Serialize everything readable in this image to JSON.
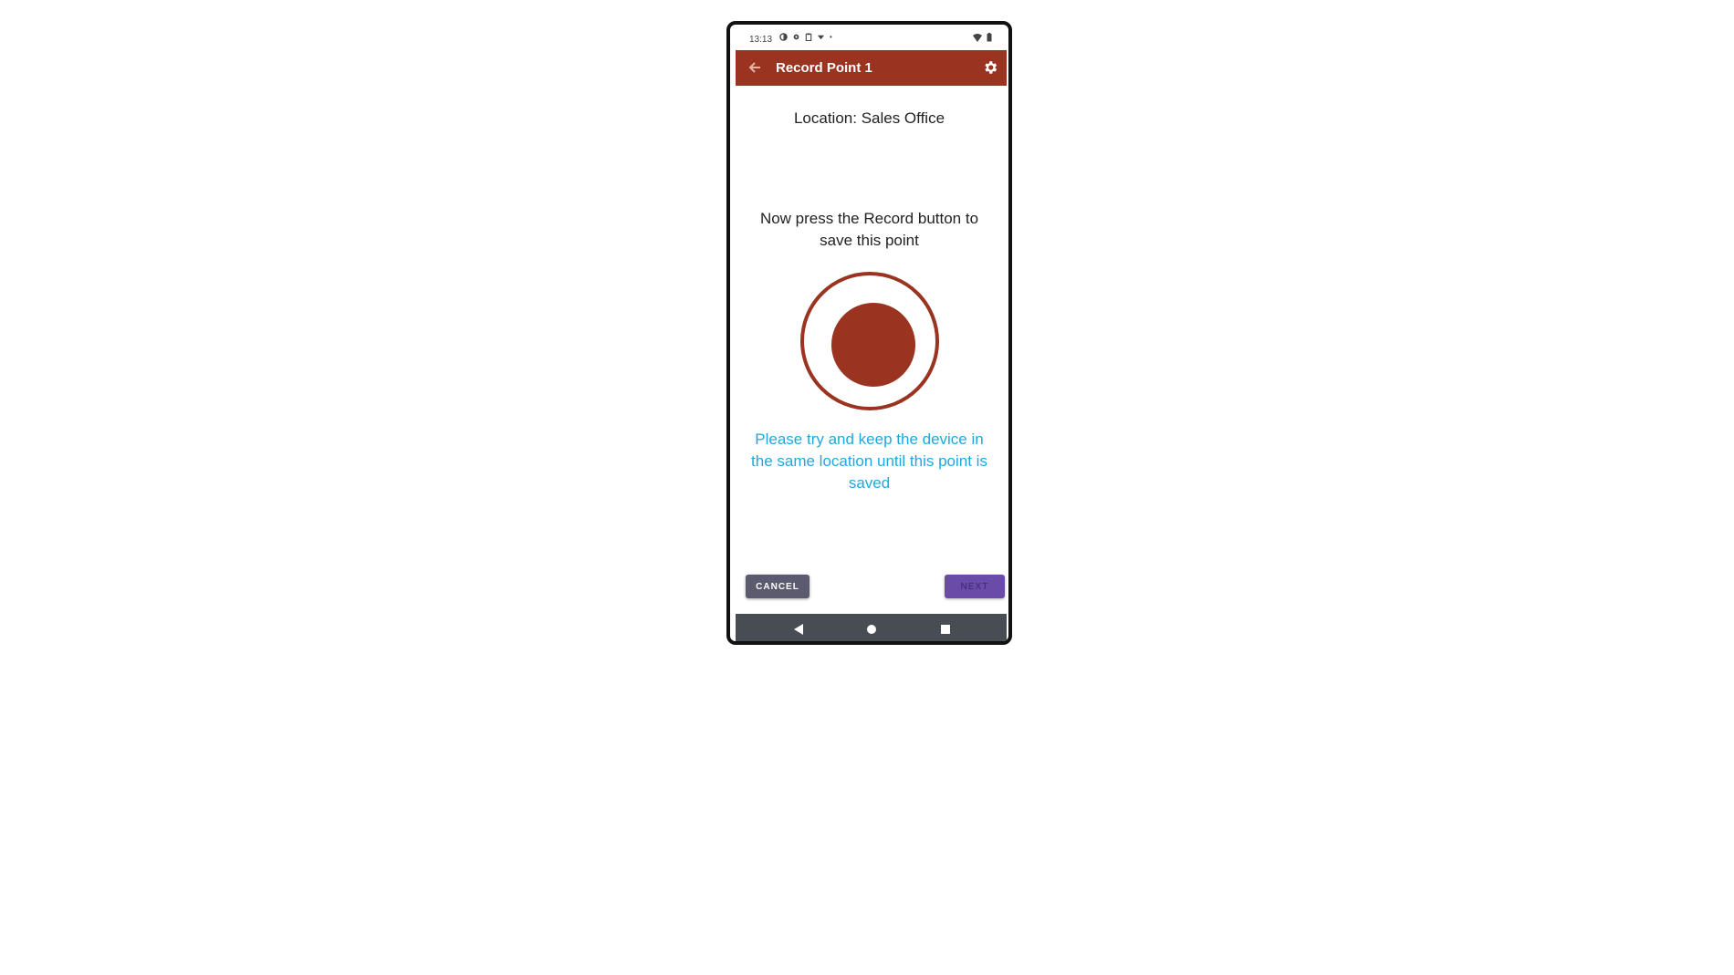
{
  "status_bar": {
    "time": "13:13"
  },
  "app_bar": {
    "title": "Record Point 1",
    "color": "#9a3320"
  },
  "main": {
    "location_text": "Location: Sales Office",
    "instruction_text": "Now press the Record button to save this point",
    "warning_text": "Please try and keep the device in the same location until this point is saved",
    "warning_color": "#1fa8e0"
  },
  "actions": {
    "cancel_label": "CANCEL",
    "next_label": "NEXT"
  },
  "icons": {
    "back": "back-arrow-icon",
    "settings": "gear-icon",
    "record": "record-icon",
    "nav_back": "nav-back-icon",
    "nav_home": "nav-home-icon",
    "nav_recents": "nav-recents-icon"
  }
}
